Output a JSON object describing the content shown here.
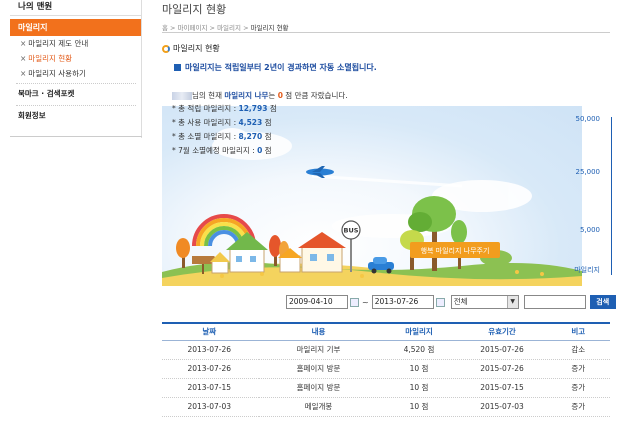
{
  "sidebar": {
    "title": "나의 맨원",
    "active": "마일리지",
    "items": [
      {
        "label": "마일리지 제도 안내",
        "current": false
      },
      {
        "label": "마일리지 현황",
        "current": true
      },
      {
        "label": "마일리지 사용하기",
        "current": false
      }
    ],
    "section2": "북마크 · 검색포켓",
    "section3": "회원정보"
  },
  "header": {
    "title": "마일리지 현황",
    "breadcrumb": [
      "홈",
      "마이페이지",
      "마일리지",
      "마일리지 현황"
    ]
  },
  "section_title": "마일리지 현황",
  "notice": "마일리지는 적립일부터 2년이 경과하면 자동 소멸됩니다.",
  "user_line": {
    "prefix": "님의 현재 ",
    "tree_label": "마일리지 나무",
    "mid": "는 ",
    "count": "0",
    "suffix": " 점 만큼 자랐습니다."
  },
  "stats": [
    {
      "label": "* 총 적립 마일리지 : ",
      "value": "12,793",
      "unit": " 점"
    },
    {
      "label": "* 총 사용 마일리지 : ",
      "value": "4,523",
      "unit": " 점"
    },
    {
      "label": "* 총 소멸 마일리지 : ",
      "value": "8,270",
      "unit": " 점"
    },
    {
      "label": "* 7월 소멸예정 마일리지 : ",
      "value": "0",
      "unit": " 점"
    }
  ],
  "gauge_ticks": [
    "50,000",
    "25,000",
    "5,000",
    "마일리지"
  ],
  "scene": {
    "bus_sign": "BUS",
    "banner": "행복 마일리지 나무주기"
  },
  "filters": {
    "date_from": "2009-04-10",
    "date_to": "2013-07-26",
    "tilde": "~",
    "select_value": "전체",
    "search_button": "검색"
  },
  "table": {
    "headers": [
      "날짜",
      "내용",
      "마일리지",
      "유효기간",
      "비고"
    ],
    "rows": [
      [
        "2013-07-26",
        "마일리지 기부",
        "4,520 점",
        "2015-07-26",
        "감소"
      ],
      [
        "2013-07-26",
        "홈페이지 방문",
        "10 점",
        "2015-07-26",
        "증가"
      ],
      [
        "2013-07-15",
        "홈페이지 방문",
        "10 점",
        "2015-07-15",
        "증가"
      ],
      [
        "2013-07-03",
        "메일개봉",
        "10 점",
        "2015-07-03",
        "증가"
      ]
    ]
  },
  "colors": {
    "accent": "#f2711c",
    "link_blue": "#1e5fb3",
    "current": "#e35b1a"
  }
}
